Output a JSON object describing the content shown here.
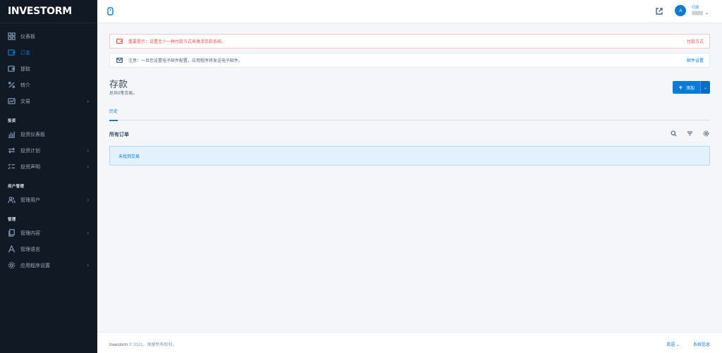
{
  "brand": {
    "logo": "INVESTORM"
  },
  "sidebar": {
    "items": [
      {
        "label": "仪表板",
        "icon": "grid-icon"
      },
      {
        "label": "订金",
        "icon": "wallet-in-icon",
        "active": true
      },
      {
        "label": "提取",
        "icon": "wallet-out-icon"
      },
      {
        "label": "转介",
        "icon": "percent-icon"
      },
      {
        "label": "交易",
        "icon": "chart-icon",
        "has_children": true
      }
    ],
    "investment_heading": "投资",
    "investment_items": [
      {
        "label": "投资仪表板",
        "icon": "bar-chart-icon"
      },
      {
        "label": "投资计划",
        "icon": "exchange-icon",
        "has_children": true
      },
      {
        "label": "投资声明",
        "icon": "list-check-icon",
        "has_children": true
      }
    ],
    "users_heading": "用户管理",
    "users_items": [
      {
        "label": "管理用户",
        "icon": "users-icon",
        "has_children": true
      }
    ],
    "manage_heading": "管理",
    "manage_items": [
      {
        "label": "管理内容",
        "icon": "files-icon",
        "has_children": true
      },
      {
        "label": "管理语言",
        "icon": "text-a-icon"
      },
      {
        "label": "应用程序设置",
        "icon": "gear-icon",
        "has_children": true
      }
    ]
  },
  "header": {
    "user_role": "行政",
    "user_name": "▒▒▒▒",
    "avatar_letter": "A"
  },
  "alerts": {
    "payment": {
      "text": "重要提示：设置至少一种付款方式来激活存款系统。",
      "link": "付款方式"
    },
    "email": {
      "text": "注意：一旦您设置电子邮件配置，应用程序将发送电子邮件。",
      "link": "邮件设置"
    }
  },
  "page": {
    "title": "存款",
    "subtitle": "总共0笔交易。",
    "add_label": "添加",
    "tab_history": "历史",
    "section_title": "所有订单",
    "empty_text": "未找到交易"
  },
  "footer": {
    "copyright_brand": "Investorm",
    "copyright_text": " © 2021。保留所有权利。",
    "language": "英语",
    "link": "系统信息"
  },
  "colors": {
    "accent": "#0a7bd9",
    "sidebar_bg": "#101924",
    "danger": "#e85347"
  }
}
